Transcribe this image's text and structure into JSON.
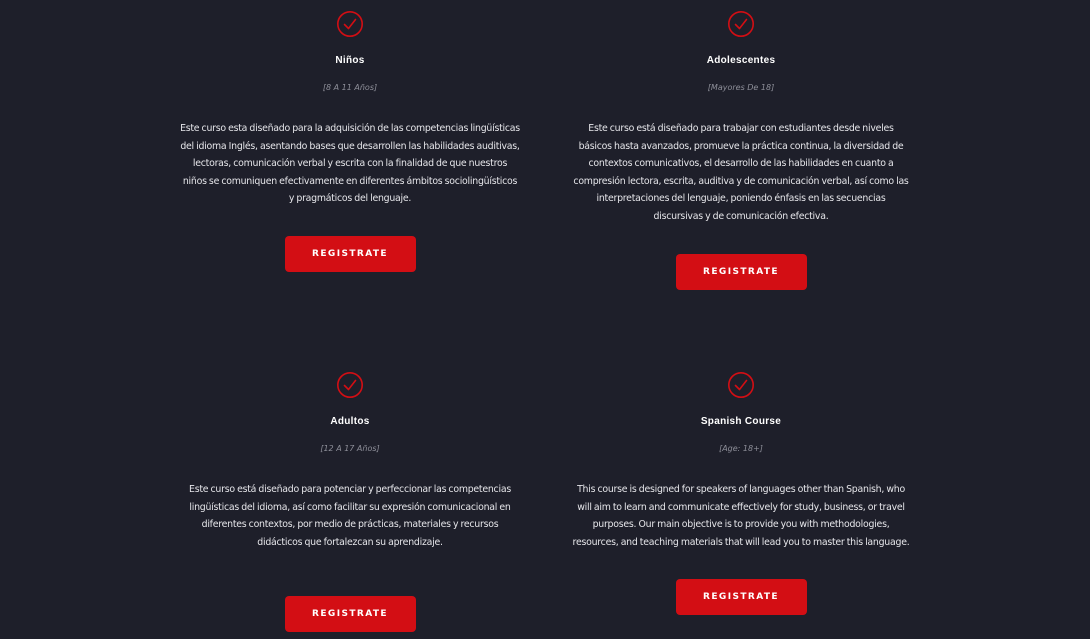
{
  "accent_color": "#d30e14",
  "background_color": "#1e1f2a",
  "courses": [
    {
      "icon": "check-circle-icon",
      "title": "Niños",
      "subtitle": "[8 A 11 Años]",
      "description": "Este curso esta diseñado para la adquisición de las competencias lingüísticas del idioma Inglés, asentando bases que desarrollen las habilidades auditivas, lectoras, comunicación verbal y escrita con la finalidad de que nuestros niños se comuniquen efectivamente en diferentes ámbitos sociolingüísticos y pragmáticos del lenguaje.",
      "button_label": "REGISTRATE"
    },
    {
      "icon": "check-circle-icon",
      "title": "Adolescentes",
      "subtitle": "[Mayores De 18]",
      "description": "Este curso está diseñado para trabajar con estudiantes desde niveles básicos hasta avanzados, promueve la práctica continua, la diversidad de contextos comunicativos, el desarrollo de las habilidades en cuanto a compresión lectora, escrita, auditiva y de comunicación verbal, así como las interpretaciones del lenguaje, poniendo énfasis en las secuencias discursivas y de comunicación efectiva.",
      "button_label": "REGISTRATE"
    },
    {
      "icon": "check-circle-icon",
      "title": "Adultos",
      "subtitle": "[12 A 17 Años]",
      "description": "Este curso está diseñado para potenciar y perfeccionar las competencias lingüísticas del idioma, así como facilitar su expresión comunicacional en diferentes contextos, por medio de prácticas, materiales y recursos didácticos que fortalezcan su aprendizaje.",
      "button_label": "REGISTRATE"
    },
    {
      "icon": "check-circle-icon",
      "title": "Spanish Course",
      "subtitle": "[Age: 18+]",
      "description": "This course is designed for speakers of languages other than Spanish, who will aim to learn and communicate effectively for study, business, or travel purposes. Our main objective is to provide you with methodologies, resources, and teaching materials that will lead you to master this language.",
      "button_label": "REGISTRATE"
    }
  ]
}
